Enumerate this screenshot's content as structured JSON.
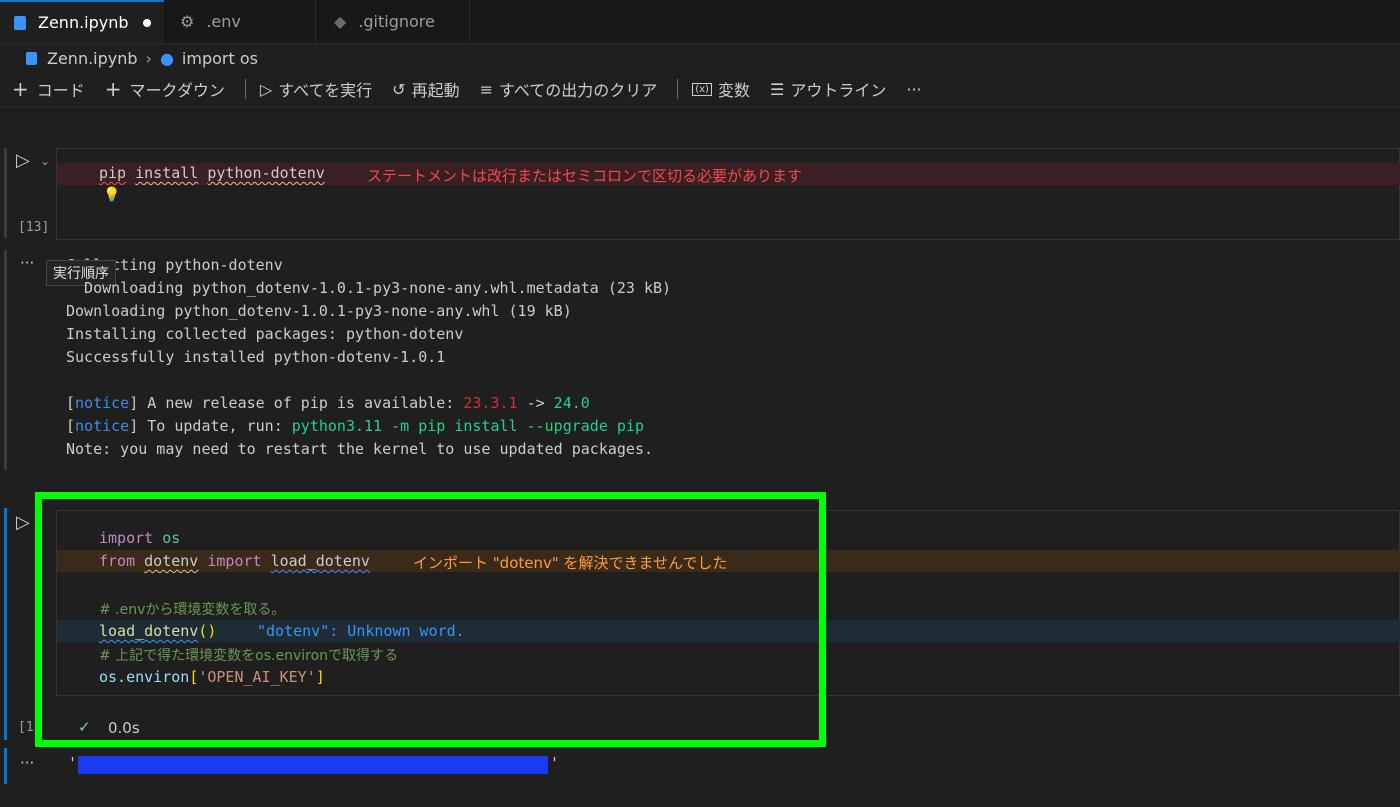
{
  "tabs": [
    {
      "label": "Zenn.ipynb",
      "icon": "notebook-icon",
      "dirty": true
    },
    {
      "label": ".env",
      "icon": "gear-icon"
    },
    {
      "label": ".gitignore",
      "icon": "git-icon"
    }
  ],
  "breadcrumb": {
    "file": "Zenn.ipynb",
    "cell": "import os"
  },
  "toolbar": {
    "code": "コード",
    "markdown": "マークダウン",
    "run_all": "すべてを実行",
    "restart": "再起動",
    "clear_outputs": "すべての出力のクリア",
    "variables": "変数",
    "outline": "アウトライン",
    "more": "···"
  },
  "cell1": {
    "exec_count": "[13]",
    "code": {
      "w1": "pip",
      "w2": "install",
      "w3": "python-dotenv"
    },
    "diagnostic": "ステートメントは改行またはセミコロンで区切る必要があります"
  },
  "output1": {
    "tooltip": "実行順序",
    "lines": [
      "Collecting python-dotenv",
      "  Downloading python_dotenv-1.0.1-py3-none-any.whl.metadata (23 kB)",
      "Downloading python_dotenv-1.0.1-py3-none-any.whl (19 kB)",
      "Installing collected packages: python-dotenv",
      "Successfully installed python-dotenv-1.0.1"
    ],
    "notice1": {
      "tag": "notice",
      "text": " A new release of pip is available: ",
      "old": "23.3.1",
      "arrow": " -> ",
      "new": "24.0"
    },
    "notice2": {
      "tag": "notice",
      "text": " To update, run: ",
      "cmd": "python3.11 -m pip install --upgrade pip"
    },
    "note": "Note: you may need to restart the kernel to use updated packages."
  },
  "cell2": {
    "exec_count": "[1",
    "import_kw": "import",
    "import_mod": "os",
    "from_kw": "from",
    "dotenv": "dotenv",
    "load_dotenv": "load_dotenv",
    "import_error": "インポート \"dotenv\" を解決できませんでした",
    "comment1": "# .envから環境変数を取る。",
    "call_name": "load_dotenv",
    "call_parens": "()",
    "unknown_word": "\"dotenv\": Unknown word.",
    "comment2": "# 上記で得た環境変数をos.environで取得する",
    "environ_obj": "os.environ",
    "environ_open": "[",
    "environ_key": "'OPEN_AI_KEY'",
    "environ_close": "]",
    "status_time": "0.0s"
  },
  "output2": {
    "quote_open": "'",
    "quote_close": "'"
  },
  "colors": {
    "accent": "#0078d4",
    "highlight_box": "#00ff00",
    "redaction": "#1a3cf0",
    "error": "#f14c4c",
    "warning": "#ff9b3f"
  }
}
